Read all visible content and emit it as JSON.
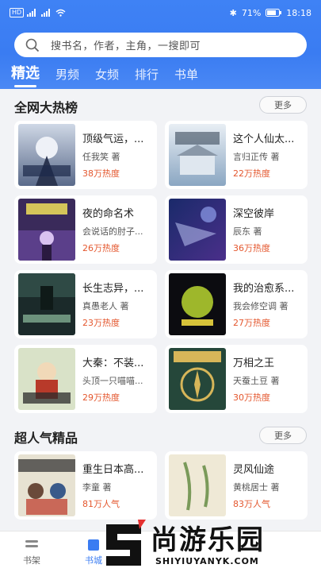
{
  "status_bar": {
    "network": "HD",
    "battery": "71%",
    "time": "18:18"
  },
  "search": {
    "placeholder": "搜书名，作者，主角，一搜即可"
  },
  "tabs": [
    "精选",
    "男频",
    "女频",
    "排行",
    "书单"
  ],
  "sections": [
    {
      "title": "全网大热榜",
      "more": "更多",
      "books": [
        {
          "title": "顶级气运，...",
          "author": "任我笑 著",
          "heat": "38万热度"
        },
        {
          "title": "这个人仙太...",
          "author": "言归正传 著",
          "heat": "22万热度"
        },
        {
          "title": "夜的命名术",
          "author": "会说话的肘子...",
          "heat": "26万热度"
        },
        {
          "title": "深空彼岸",
          "author": "辰东 著",
          "heat": "36万热度"
        },
        {
          "title": "长生志异，...",
          "author": "真愚老人 著",
          "heat": "23万热度"
        },
        {
          "title": "我的治愈系...",
          "author": "我会修空调 著",
          "heat": "27万热度"
        },
        {
          "title": "大秦：不装...",
          "author": "头顶一只喵喵...",
          "heat": "29万热度"
        },
        {
          "title": "万相之王",
          "author": "天蚕土豆 著",
          "heat": "30万热度"
        }
      ]
    },
    {
      "title": "超人气精品",
      "more": "更多",
      "books": [
        {
          "title": "重生日本高...",
          "author": "李童 著",
          "heat": "81万人气"
        },
        {
          "title": "灵风仙途",
          "author": "黄桃居士 著",
          "heat": "83万人气"
        }
      ]
    }
  ],
  "bottom_nav": {
    "shelf": "书架",
    "store": "书城"
  },
  "watermark": {
    "big": "尚游乐园",
    "small": "SHIYIUYANYK.COM"
  },
  "colors": {
    "accent": "#3a7cf2",
    "heat": "#e4572e"
  }
}
